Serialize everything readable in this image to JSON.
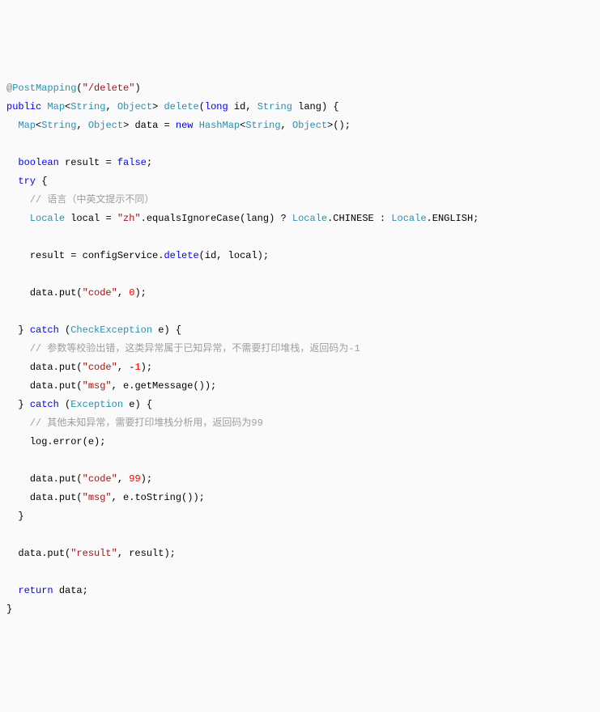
{
  "code": {
    "lines": [
      {
        "indent": 0,
        "tokens": [
          {
            "t": "annotation",
            "v": "@"
          },
          {
            "t": "type",
            "v": "PostMapping"
          },
          {
            "t": "plain",
            "v": "("
          },
          {
            "t": "string",
            "v": "\"/delete\""
          },
          {
            "t": "plain",
            "v": ")"
          }
        ]
      },
      {
        "indent": 0,
        "tokens": [
          {
            "t": "keyword",
            "v": "public"
          },
          {
            "t": "plain",
            "v": " "
          },
          {
            "t": "type",
            "v": "Map"
          },
          {
            "t": "plain",
            "v": "<"
          },
          {
            "t": "type",
            "v": "String"
          },
          {
            "t": "plain",
            "v": ", "
          },
          {
            "t": "type",
            "v": "Object"
          },
          {
            "t": "plain",
            "v": "> "
          },
          {
            "t": "type",
            "v": "delete"
          },
          {
            "t": "plain",
            "v": "("
          },
          {
            "t": "keyword",
            "v": "long"
          },
          {
            "t": "plain",
            "v": " id, "
          },
          {
            "t": "type",
            "v": "String"
          },
          {
            "t": "plain",
            "v": " lang) {"
          }
        ]
      },
      {
        "indent": 1,
        "tokens": [
          {
            "t": "type",
            "v": "Map"
          },
          {
            "t": "plain",
            "v": "<"
          },
          {
            "t": "type",
            "v": "String"
          },
          {
            "t": "plain",
            "v": ", "
          },
          {
            "t": "type",
            "v": "Object"
          },
          {
            "t": "plain",
            "v": "> data = "
          },
          {
            "t": "keyword",
            "v": "new"
          },
          {
            "t": "plain",
            "v": " "
          },
          {
            "t": "type",
            "v": "HashMap"
          },
          {
            "t": "plain",
            "v": "<"
          },
          {
            "t": "type",
            "v": "String"
          },
          {
            "t": "plain",
            "v": ", "
          },
          {
            "t": "type",
            "v": "Object"
          },
          {
            "t": "plain",
            "v": ">();"
          }
        ]
      },
      {
        "indent": 0,
        "tokens": [
          {
            "t": "plain",
            "v": " "
          }
        ]
      },
      {
        "indent": 1,
        "tokens": [
          {
            "t": "keyword",
            "v": "boolean"
          },
          {
            "t": "plain",
            "v": " result = "
          },
          {
            "t": "keyword",
            "v": "false"
          },
          {
            "t": "plain",
            "v": ";"
          }
        ]
      },
      {
        "indent": 1,
        "tokens": [
          {
            "t": "keyword",
            "v": "try"
          },
          {
            "t": "plain",
            "v": " {"
          }
        ]
      },
      {
        "indent": 2,
        "tokens": [
          {
            "t": "comment",
            "v": "// 语言（中英文提示不同）"
          }
        ]
      },
      {
        "indent": 2,
        "tokens": [
          {
            "t": "type",
            "v": "Locale"
          },
          {
            "t": "plain",
            "v": " local = "
          },
          {
            "t": "string",
            "v": "\"zh\""
          },
          {
            "t": "plain",
            "v": ".equalsIgnoreCase(lang) ? "
          },
          {
            "t": "type",
            "v": "Locale"
          },
          {
            "t": "plain",
            "v": ".CHINESE : "
          },
          {
            "t": "type",
            "v": "Locale"
          },
          {
            "t": "plain",
            "v": ".ENGLISH;"
          }
        ]
      },
      {
        "indent": 0,
        "tokens": [
          {
            "t": "plain",
            "v": " "
          }
        ]
      },
      {
        "indent": 2,
        "tokens": [
          {
            "t": "plain",
            "v": "result = configService."
          },
          {
            "t": "keyword",
            "v": "delete"
          },
          {
            "t": "plain",
            "v": "(id, local);"
          }
        ]
      },
      {
        "indent": 0,
        "tokens": [
          {
            "t": "plain",
            "v": " "
          }
        ]
      },
      {
        "indent": 2,
        "tokens": [
          {
            "t": "plain",
            "v": "data.put("
          },
          {
            "t": "string",
            "v": "\"code\""
          },
          {
            "t": "plain",
            "v": ", "
          },
          {
            "t": "number",
            "v": "0"
          },
          {
            "t": "plain",
            "v": ");"
          }
        ]
      },
      {
        "indent": 0,
        "tokens": [
          {
            "t": "plain",
            "v": " "
          }
        ]
      },
      {
        "indent": 1,
        "tokens": [
          {
            "t": "plain",
            "v": "} "
          },
          {
            "t": "keyword",
            "v": "catch"
          },
          {
            "t": "plain",
            "v": " ("
          },
          {
            "t": "type",
            "v": "CheckException"
          },
          {
            "t": "plain",
            "v": " e) {"
          }
        ]
      },
      {
        "indent": 2,
        "tokens": [
          {
            "t": "comment",
            "v": "// 参数等校验出错，这类异常属于已知异常，不需要打印堆栈，返回码为-1"
          }
        ]
      },
      {
        "indent": 2,
        "tokens": [
          {
            "t": "plain",
            "v": "data.put("
          },
          {
            "t": "string",
            "v": "\"code\""
          },
          {
            "t": "plain",
            "v": ", -"
          },
          {
            "t": "number",
            "v": "1"
          },
          {
            "t": "plain",
            "v": ");"
          }
        ]
      },
      {
        "indent": 2,
        "tokens": [
          {
            "t": "plain",
            "v": "data.put("
          },
          {
            "t": "string",
            "v": "\"msg\""
          },
          {
            "t": "plain",
            "v": ", e.getMessage());"
          }
        ]
      },
      {
        "indent": 1,
        "tokens": [
          {
            "t": "plain",
            "v": "} "
          },
          {
            "t": "keyword",
            "v": "catch"
          },
          {
            "t": "plain",
            "v": " ("
          },
          {
            "t": "type",
            "v": "Exception"
          },
          {
            "t": "plain",
            "v": " e) {"
          }
        ]
      },
      {
        "indent": 2,
        "tokens": [
          {
            "t": "comment",
            "v": "// 其他未知异常，需要打印堆栈分析用，返回码为99"
          }
        ]
      },
      {
        "indent": 2,
        "tokens": [
          {
            "t": "plain",
            "v": "log.error(e);"
          }
        ]
      },
      {
        "indent": 0,
        "tokens": [
          {
            "t": "plain",
            "v": " "
          }
        ]
      },
      {
        "indent": 2,
        "tokens": [
          {
            "t": "plain",
            "v": "data.put("
          },
          {
            "t": "string",
            "v": "\"code\""
          },
          {
            "t": "plain",
            "v": ", "
          },
          {
            "t": "number",
            "v": "99"
          },
          {
            "t": "plain",
            "v": ");"
          }
        ]
      },
      {
        "indent": 2,
        "tokens": [
          {
            "t": "plain",
            "v": "data.put("
          },
          {
            "t": "string",
            "v": "\"msg\""
          },
          {
            "t": "plain",
            "v": ", e.toString());"
          }
        ]
      },
      {
        "indent": 1,
        "tokens": [
          {
            "t": "plain",
            "v": "}"
          }
        ]
      },
      {
        "indent": 0,
        "tokens": [
          {
            "t": "plain",
            "v": " "
          }
        ]
      },
      {
        "indent": 1,
        "tokens": [
          {
            "t": "plain",
            "v": "data.put("
          },
          {
            "t": "string",
            "v": "\"result\""
          },
          {
            "t": "plain",
            "v": ", result);"
          }
        ]
      },
      {
        "indent": 0,
        "tokens": [
          {
            "t": "plain",
            "v": " "
          }
        ]
      },
      {
        "indent": 1,
        "tokens": [
          {
            "t": "keyword",
            "v": "return"
          },
          {
            "t": "plain",
            "v": " data;"
          }
        ]
      },
      {
        "indent": 0,
        "tokens": [
          {
            "t": "plain",
            "v": "}"
          }
        ]
      }
    ],
    "indent_unit": "  "
  }
}
